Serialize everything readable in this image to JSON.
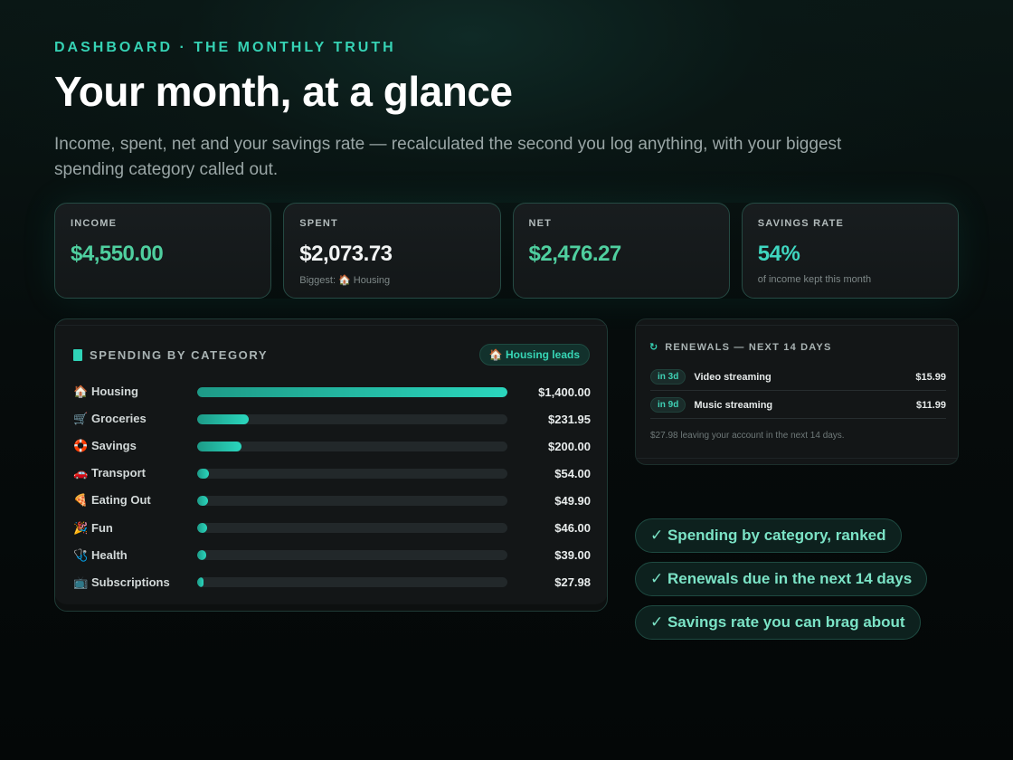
{
  "header": {
    "eyebrow": "DASHBOARD · THE MONTHLY TRUTH",
    "title": "Your month, at a glance",
    "subtitle": "Income, spent, net and your savings rate — recalculated the second you log anything, with your biggest spending category called out."
  },
  "stats": [
    {
      "label": "INCOME",
      "value": "$4,550.00",
      "note": "",
      "color": "#4fcf9f"
    },
    {
      "label": "SPENT",
      "value": "$2,073.73",
      "note": "Biggest: 🏠 Housing",
      "color": "#f2f4f4"
    },
    {
      "label": "NET",
      "value": "$2,476.27",
      "note": "",
      "color": "#4fcf9f"
    },
    {
      "label": "SAVINGS RATE",
      "value": "54%",
      "note": "of income kept this month",
      "color": "#3fd6c0"
    }
  ],
  "categories": {
    "title": "SPENDING BY CATEGORY",
    "badge": "🏠 Housing leads",
    "items": [
      {
        "icon": "🏠",
        "name": "Housing",
        "amount": "$1,400.00",
        "value": 1400.0
      },
      {
        "icon": "🛒",
        "name": "Groceries",
        "amount": "$231.95",
        "value": 231.95
      },
      {
        "icon": "🛟",
        "name": "Savings",
        "amount": "$200.00",
        "value": 200.0
      },
      {
        "icon": "🚗",
        "name": "Transport",
        "amount": "$54.00",
        "value": 54.0
      },
      {
        "icon": "🍕",
        "name": "Eating Out",
        "amount": "$49.90",
        "value": 49.9
      },
      {
        "icon": "🎉",
        "name": "Fun",
        "amount": "$46.00",
        "value": 46.0
      },
      {
        "icon": "🩺",
        "name": "Health",
        "amount": "$39.00",
        "value": 39.0
      },
      {
        "icon": "📺",
        "name": "Subscriptions",
        "amount": "$27.98",
        "value": 27.98
      }
    ]
  },
  "renewals": {
    "icon": "↻",
    "title": "RENEWALS — NEXT 14 DAYS",
    "items": [
      {
        "due": "in 3d",
        "name": "Video streaming",
        "price": "$15.99"
      },
      {
        "due": "in 9d",
        "name": "Music streaming",
        "price": "$11.99"
      }
    ],
    "footer": "$27.98 leaving your account in the next 14 days."
  },
  "features": [
    "✓ Spending by category, ranked",
    "✓ Renewals due in the next 14 days",
    "✓ Savings rate you can brag about"
  ],
  "colors": {
    "accent": "#36d2b4",
    "background": "#060c0c",
    "card": "#131617"
  }
}
